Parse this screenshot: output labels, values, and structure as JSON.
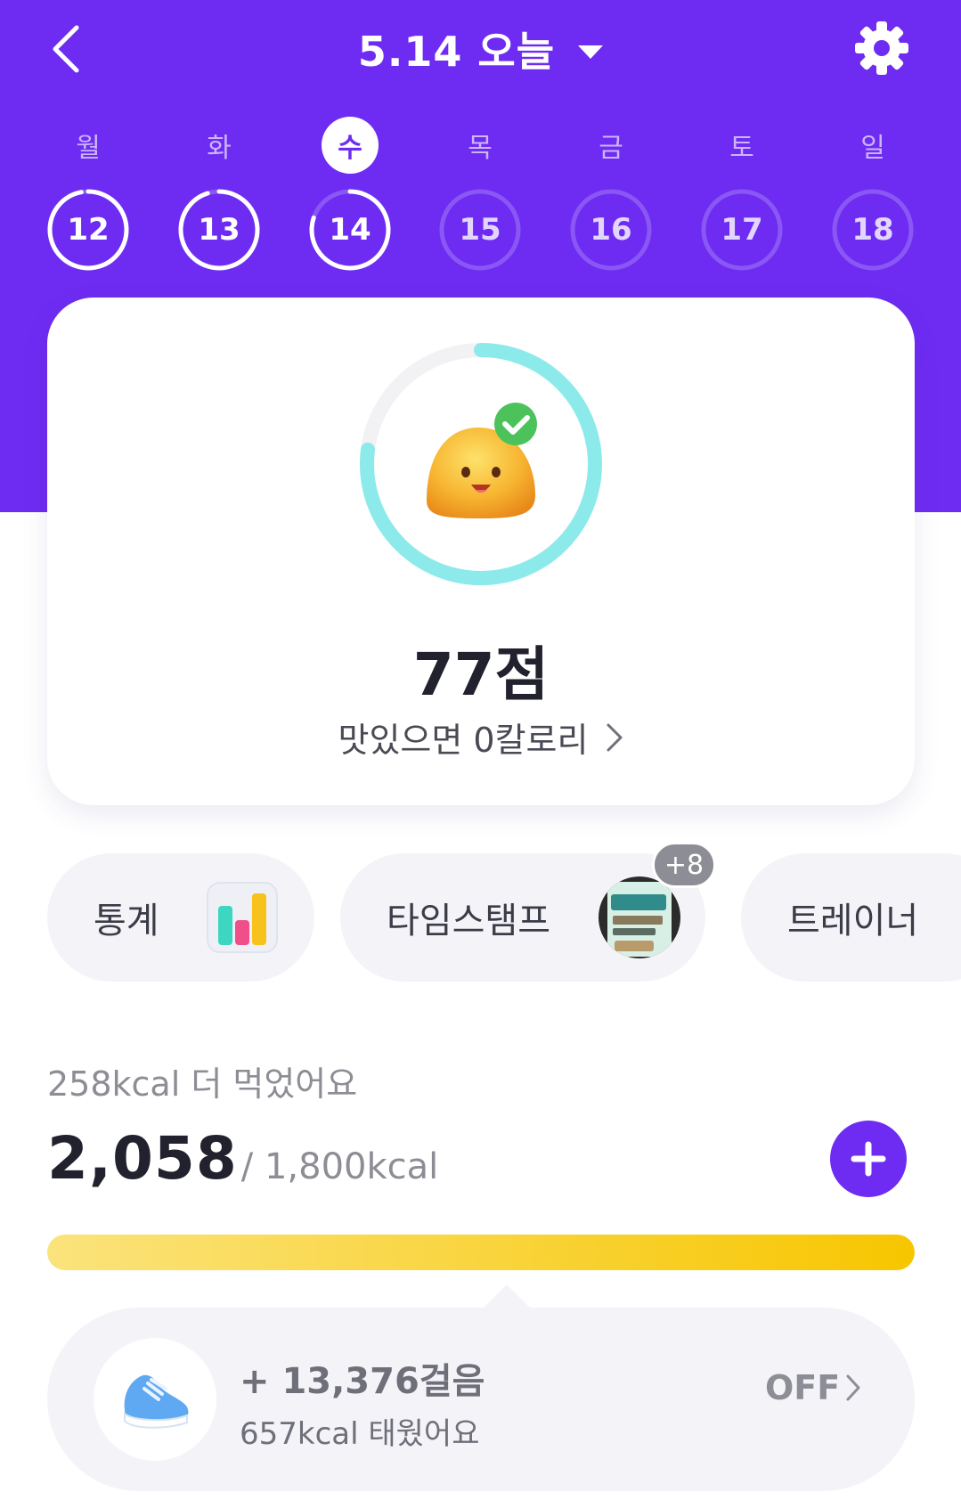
{
  "header": {
    "title": "5.14 오늘",
    "colors": {
      "brand": "#6e2cf2",
      "ring_active": "#ffffff"
    }
  },
  "week": {
    "weekdays": [
      "월",
      "화",
      "수",
      "목",
      "금",
      "토",
      "일"
    ],
    "active_index": 2,
    "days": [
      {
        "label": "12",
        "progress": 0.97
      },
      {
        "label": "13",
        "progress": 0.95
      },
      {
        "label": "14",
        "progress": 0.8
      },
      {
        "label": "15",
        "progress": 0
      },
      {
        "label": "16",
        "progress": 0
      },
      {
        "label": "17",
        "progress": 0
      },
      {
        "label": "18",
        "progress": 0
      }
    ]
  },
  "score_card": {
    "score": "77점",
    "score_value": 77,
    "subtitle": "맛있으면 0칼로리",
    "icons": {
      "mascot": "smiling-blob",
      "check": "check-badge-icon",
      "chevron": "chevron-right-icon"
    },
    "ring_color": "#8deaeb"
  },
  "chips": [
    {
      "label": "통계",
      "icon": "bar-chart-icon"
    },
    {
      "label": "타임스탬프",
      "badge": "+8",
      "icon": "food-photo-thumbnail"
    },
    {
      "label": "트레이너"
    }
  ],
  "calories": {
    "message": "258kcal 더 먹었어요",
    "consumed": "2,058",
    "goal": "/ 1,800kcal",
    "consumed_value": 2058,
    "goal_value": 1800,
    "bar_color": "#f7c600"
  },
  "steps": {
    "count": "+ 13,376걸음",
    "burned": "657kcal 태웠어요",
    "toggle": "OFF",
    "icon": "sneaker-icon"
  }
}
